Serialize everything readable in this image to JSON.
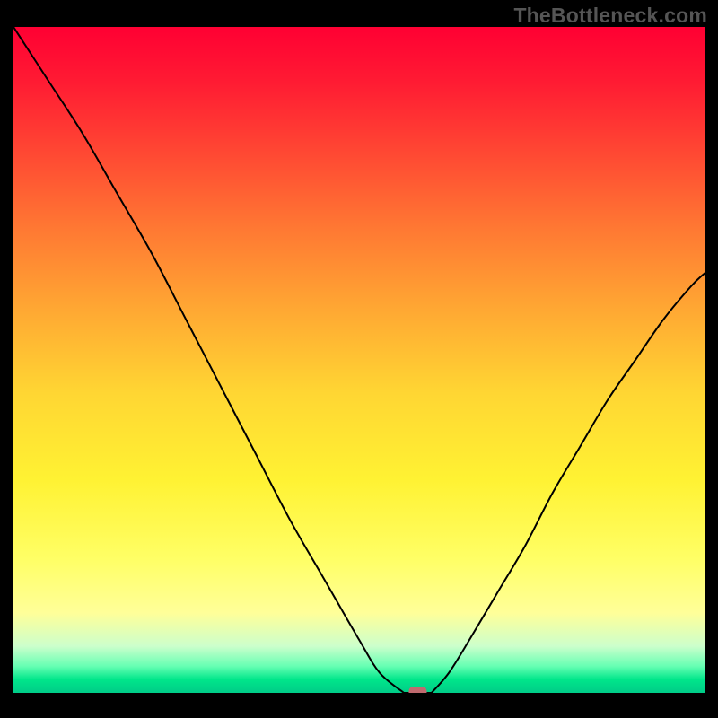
{
  "watermark": "TheBottleneck.com",
  "chart_data": {
    "type": "line",
    "title": "",
    "xlabel": "",
    "ylabel": "",
    "xlim": [
      0,
      100
    ],
    "ylim": [
      0,
      100
    ],
    "grid": false,
    "legend": false,
    "series": [
      {
        "name": "left_branch",
        "x": [
          0,
          5,
          10,
          15,
          20,
          25,
          30,
          35,
          40,
          45,
          50,
          53,
          56.5
        ],
        "y": [
          100,
          92,
          84,
          75,
          66,
          56,
          46,
          36,
          26,
          17,
          8,
          3,
          0
        ]
      },
      {
        "name": "floor",
        "x": [
          56.5,
          60.5
        ],
        "y": [
          0,
          0
        ]
      },
      {
        "name": "right_branch",
        "x": [
          60.5,
          63,
          66,
          70,
          74,
          78,
          82,
          86,
          90,
          94,
          98,
          100
        ],
        "y": [
          0,
          3,
          8,
          15,
          22,
          30,
          37,
          44,
          50,
          56,
          61,
          63
        ]
      }
    ],
    "marker": {
      "x": 58.5,
      "y": 0,
      "color": "#c06a6f"
    },
    "background": {
      "type": "vertical_gradient",
      "stops": [
        {
          "pos": 0.0,
          "color": "#ff0033"
        },
        {
          "pos": 0.3,
          "color": "#ff7733"
        },
        {
          "pos": 0.55,
          "color": "#ffd633"
        },
        {
          "pos": 0.8,
          "color": "#ffff66"
        },
        {
          "pos": 0.93,
          "color": "#ccffcc"
        },
        {
          "pos": 1.0,
          "color": "#00cc88"
        }
      ]
    }
  }
}
